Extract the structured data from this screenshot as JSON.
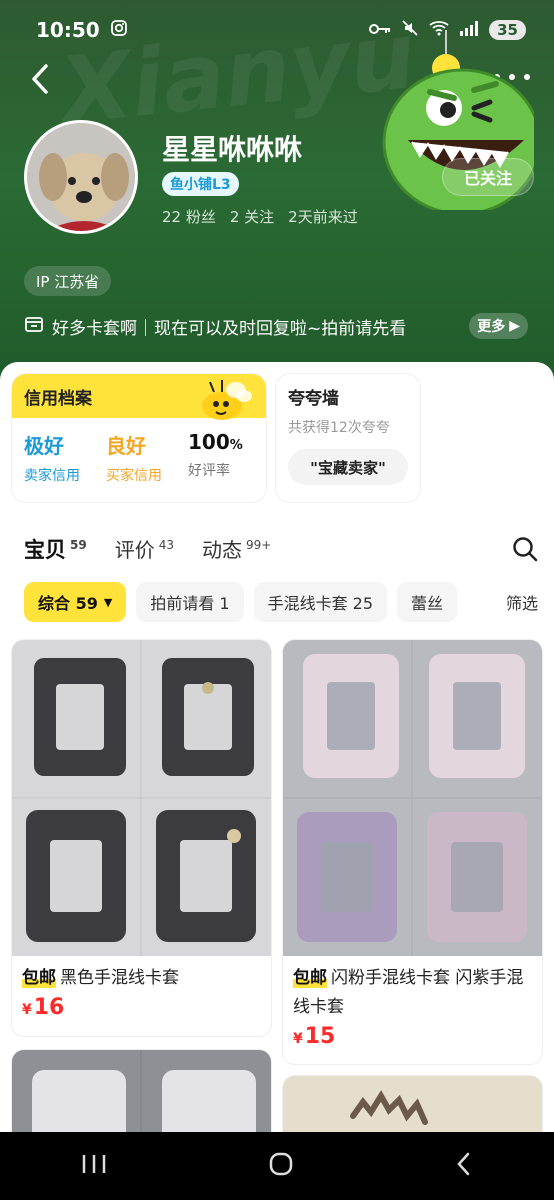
{
  "status_bar": {
    "time": "10:50",
    "signal": "5G",
    "battery": "35"
  },
  "profile": {
    "nickname": "星星咻咻咻",
    "shop_badge": "鱼小铺L3",
    "fans": "22 粉丝",
    "following": "2 关注",
    "last_seen": "2天前来过",
    "follow_button": "已关注",
    "ip": "IP 江苏省",
    "intro": "好多卡套啊｜现在可以及时回复啦~拍前请先看",
    "more_label": "更多"
  },
  "credit": {
    "title": "信用档案",
    "seller_credit_value": "极好",
    "seller_credit_label": "卖家信用",
    "buyer_credit_value": "良好",
    "buyer_credit_label": "买家信用",
    "positive_rate_value": "100",
    "positive_rate_unit": "%",
    "positive_rate_label": "好评率"
  },
  "praise": {
    "title": "夸夸墙",
    "subtitle": "共获得12次夸夸",
    "tag": "\"宝藏卖家\""
  },
  "tabs": [
    {
      "label": "宝贝",
      "count": "59"
    },
    {
      "label": "评价",
      "count": "43"
    },
    {
      "label": "动态",
      "count": "99+"
    }
  ],
  "chips": [
    {
      "label": "综合 59"
    },
    {
      "label": "拍前请看 1"
    },
    {
      "label": "手混线卡套 25"
    },
    {
      "label": "蕾丝"
    }
  ],
  "filter_label": "筛选",
  "products": [
    {
      "tag": "包邮",
      "title": "黑色手混线卡套",
      "currency": "¥",
      "price": "16"
    },
    {
      "tag": "包邮",
      "title": "闪粉手混线卡套 闪紫手混线卡套",
      "currency": "¥",
      "price": "15"
    }
  ],
  "colors": {
    "header_green": "#2a6a34",
    "accent_yellow": "#ffe33a",
    "price_red": "#ff2b2b",
    "credit_blue": "#1a9ad6",
    "credit_orange": "#f5a623"
  }
}
